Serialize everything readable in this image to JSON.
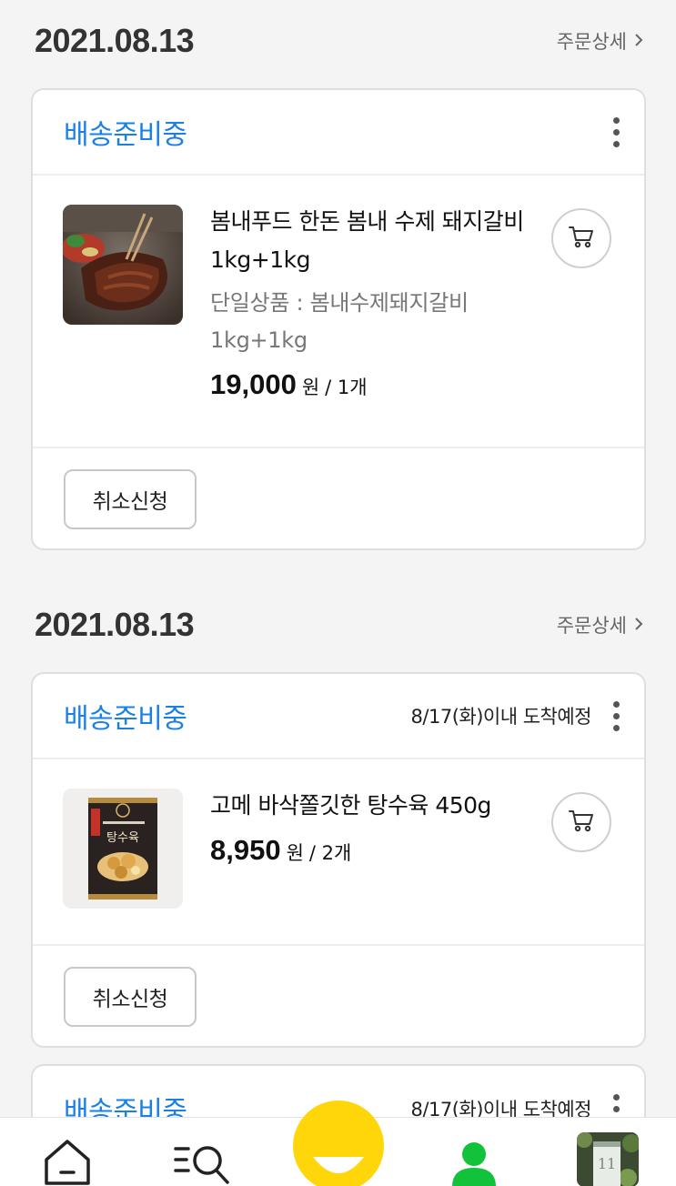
{
  "orders": [
    {
      "date": "2021.08.13",
      "detail_label": "주문상세",
      "status": "배송준비중",
      "eta": "",
      "product": {
        "title": "봄내푸드 한돈 봄내 수제 돼지갈비 1kg+1kg",
        "option": "단일상품 : 봄내수제돼지갈비 1kg+1kg",
        "price": "19,000",
        "currency": "원",
        "quantity": "/ 1개"
      },
      "cancel_label": "취소신청"
    },
    {
      "date": "2021.08.13",
      "detail_label": "주문상세",
      "status": "배송준비중",
      "eta": "8/17(화)이내 도착예정",
      "product": {
        "title": "고메 바삭쫄깃한 탕수육 450g",
        "option": "",
        "price": "8,950",
        "currency": "원",
        "quantity": "/ 2개"
      },
      "cancel_label": "취소신청"
    },
    {
      "status": "배송준비중",
      "eta": "8/17(화)이내 도착예정"
    }
  ],
  "product_images": [
    {
      "icon": "bbq-ribs-photo"
    },
    {
      "icon": "tangsuyuk-package-photo",
      "package_text": "탕수육"
    }
  ],
  "nav": {
    "items": [
      "home-icon",
      "menu-search-icon",
      "smile-emoji-button",
      "my-page-icon",
      "recent-item-thumbnail"
    ],
    "recent_badge": "11"
  },
  "colors": {
    "status_blue": "#1b80e4",
    "active_green": "#12c23a",
    "emoji_yellow": "#ffd60a"
  }
}
